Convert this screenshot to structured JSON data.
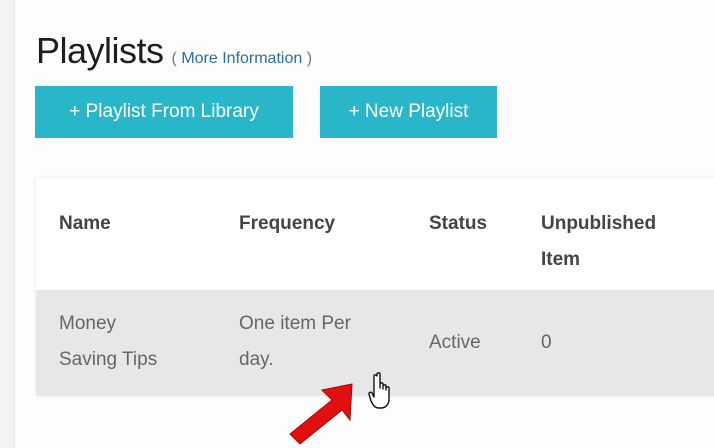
{
  "header": {
    "title": "Playlists",
    "more_info_open": "(",
    "more_info_link": "More Information",
    "more_info_close": ")"
  },
  "toolbar": {
    "playlist_from_library_label": "+ Playlist From Library",
    "new_playlist_label": "+ New Playlist"
  },
  "table": {
    "headers": {
      "name": "Name",
      "frequency": "Frequency",
      "status": "Status",
      "unpublished_line1": "Unpublished",
      "unpublished_line2": "Item"
    },
    "rows": [
      {
        "name_line1": "Money",
        "name_line2": "Saving Tips",
        "frequency_line1": "One item Per",
        "frequency_line2": "day.",
        "status": "Active",
        "unpublished": "0"
      }
    ]
  },
  "colors": {
    "accent": "#29b6c9",
    "row_highlight": "#e7e7e7",
    "annotation_arrow": "#e01010"
  },
  "icons": {
    "cursor": "hand-pointer-icon",
    "annotation": "red-arrow-icon"
  }
}
